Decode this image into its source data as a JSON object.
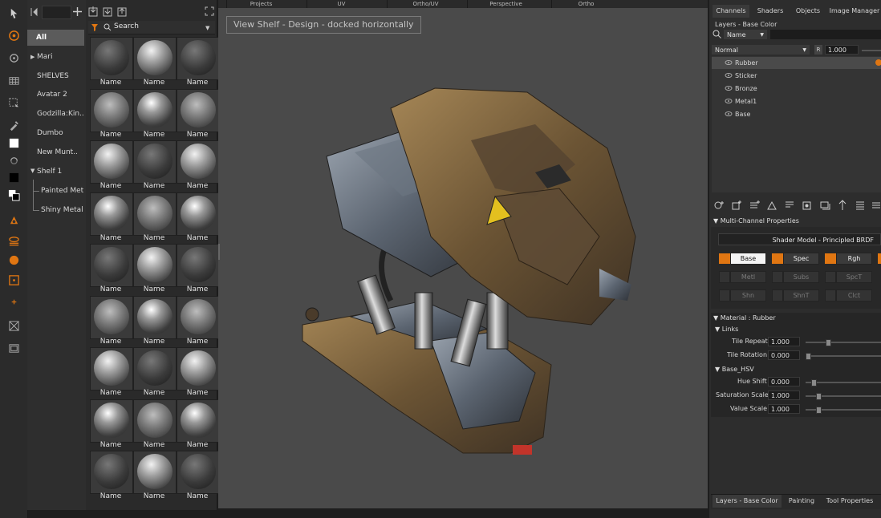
{
  "viewport_tabs": [
    "Projects",
    "UV",
    "Ortho/UV",
    "Perspective",
    "Ortho"
  ],
  "viewport_label": "View Shelf - Design - docked horizontally",
  "shelf_tree": {
    "items": [
      "All",
      "Mari",
      "SHELVES",
      "Avatar 2",
      "Godzilla:Kin..",
      "Dumbo",
      "New Munt..",
      "Shelf 1",
      "Painted Met..",
      "Shiny Metal"
    ]
  },
  "shelf_grid": {
    "search_placeholder": "Search",
    "item_label": "Name",
    "rows": 9,
    "cols": 3
  },
  "right_panel": {
    "tabs": [
      "Channels",
      "Shaders",
      "Objects",
      "Image Manager"
    ],
    "layers_title": "Layers - Base Color",
    "name_dropdown": "Name",
    "blend_mode": "Normal",
    "r_label": "R",
    "opacity": "1.000",
    "layers": [
      "Rubber",
      "Sticker",
      "Bronze",
      "Metal1",
      "Base"
    ],
    "multi_channel_title": "Multi-Channel Properties",
    "shader_model": "Shader Model - Principled BRDF",
    "channels_row1": [
      "Base",
      "Spec",
      "Rgh"
    ],
    "channels_row2": [
      "Metl",
      "Subs",
      "SpcT"
    ],
    "channels_row3": [
      "Shn",
      "ShnT",
      "Clct"
    ],
    "material_title": "Material : Rubber",
    "links_title": "Links",
    "tile_repeat_label": "Tile Repeat",
    "tile_repeat_value": "1.000",
    "tile_rotation_label": "Tile Rotation",
    "tile_rotation_value": "0.000",
    "base_hsv_title": "Base_HSV",
    "hue_shift_label": "Hue Shift",
    "hue_shift_value": "0.000",
    "saturation_label": "Saturation Scale",
    "saturation_value": "1.000",
    "value_label": "Value Scale",
    "value_value": "1.000",
    "bottom_tabs": [
      "Layers - Base Color",
      "Painting",
      "Tool Properties"
    ]
  },
  "colors": {
    "accent": "#e07612",
    "bg": "#2d2d2d",
    "viewport": "#4a4a4a"
  }
}
